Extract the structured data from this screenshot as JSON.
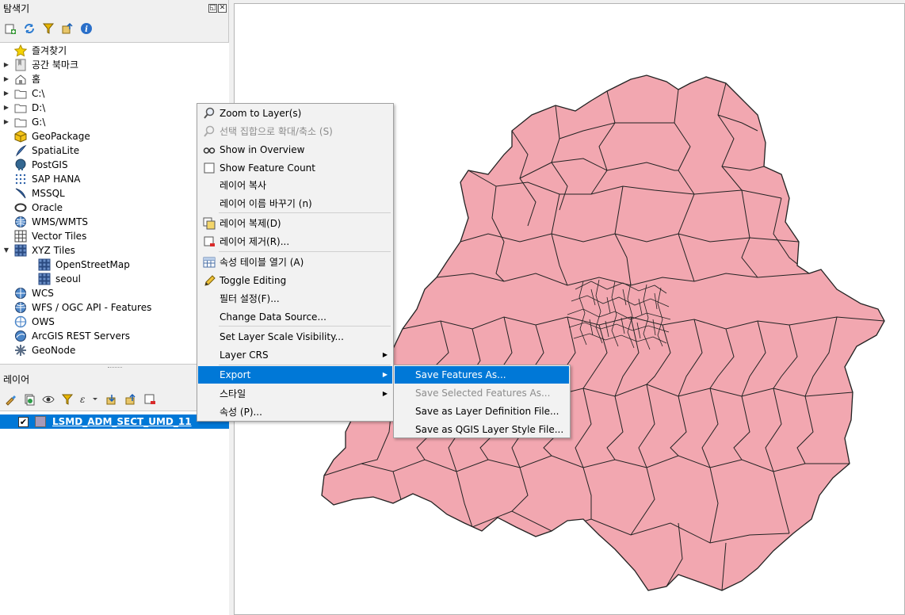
{
  "browser_panel": {
    "title": "탐색기",
    "tree": [
      {
        "label": "즐겨찾기",
        "icon": "star-icon",
        "arrow": ""
      },
      {
        "label": "공간 북마크",
        "icon": "bookmark-icon",
        "arrow": "▶"
      },
      {
        "label": "홈",
        "icon": "home-icon",
        "arrow": "▶"
      },
      {
        "label": "C:\\",
        "icon": "folder-icon",
        "arrow": "▶"
      },
      {
        "label": "D:\\",
        "icon": "folder-icon",
        "arrow": "▶"
      },
      {
        "label": "G:\\",
        "icon": "folder-icon",
        "arrow": "▶"
      },
      {
        "label": "GeoPackage",
        "icon": "geopackage-icon",
        "arrow": ""
      },
      {
        "label": "SpatiaLite",
        "icon": "spatialite-icon",
        "arrow": ""
      },
      {
        "label": "PostGIS",
        "icon": "postgis-icon",
        "arrow": ""
      },
      {
        "label": "SAP HANA",
        "icon": "sap-hana-icon",
        "arrow": ""
      },
      {
        "label": "MSSQL",
        "icon": "mssql-icon",
        "arrow": ""
      },
      {
        "label": "Oracle",
        "icon": "oracle-icon",
        "arrow": ""
      },
      {
        "label": "WMS/WMTS",
        "icon": "wms-icon",
        "arrow": ""
      },
      {
        "label": "Vector Tiles",
        "icon": "vector-tiles-icon",
        "arrow": ""
      },
      {
        "label": "XYZ Tiles",
        "icon": "xyz-tiles-icon",
        "arrow": "▼"
      },
      {
        "label": "OpenStreetMap",
        "icon": "tile-grid-icon",
        "arrow": ""
      },
      {
        "label": "seoul",
        "icon": "tile-grid-icon",
        "arrow": ""
      },
      {
        "label": "WCS",
        "icon": "wcs-icon",
        "arrow": ""
      },
      {
        "label": "WFS / OGC API - Features",
        "icon": "wfs-icon",
        "arrow": ""
      },
      {
        "label": "OWS",
        "icon": "ows-icon",
        "arrow": ""
      },
      {
        "label": "ArcGIS REST Servers",
        "icon": "arcgis-icon",
        "arrow": ""
      },
      {
        "label": "GeoNode",
        "icon": "geonode-icon",
        "arrow": ""
      }
    ]
  },
  "layers_panel": {
    "title": "레이어",
    "layer": {
      "name": "LSMD_ADM_SECT_UMD_11",
      "checked": "✔",
      "color": "#a89ab8"
    }
  },
  "context_menu": {
    "items": [
      {
        "label": "Zoom to Layer(s)",
        "icon": "zoom-layer-icon",
        "state": "normal"
      },
      {
        "label": "선택 집합으로 확대/축소 (S)",
        "icon": "zoom-selection-icon",
        "state": "disabled"
      },
      {
        "label": "Show in Overview",
        "icon": "overview-icon",
        "state": "normal"
      },
      {
        "label": "Show Feature Count",
        "icon": "checkbox-icon",
        "state": "normal"
      },
      {
        "label": "레이어 복사",
        "icon": "",
        "state": "normal"
      },
      {
        "label": "레이어 이름 바꾸기 (n)",
        "icon": "",
        "state": "normal"
      },
      {
        "label": "레이어 복제(D)",
        "icon": "duplicate-layer-icon",
        "state": "normal"
      },
      {
        "label": "레이어 제거(R)...",
        "icon": "remove-layer-icon",
        "state": "normal"
      },
      {
        "label": "속성 테이블 열기 (A)",
        "icon": "attribute-table-icon",
        "state": "normal"
      },
      {
        "label": "Toggle Editing",
        "icon": "pencil-icon",
        "state": "normal"
      },
      {
        "label": "필터 설정(F)...",
        "icon": "",
        "state": "normal"
      },
      {
        "label": "Change Data Source...",
        "icon": "",
        "state": "normal"
      },
      {
        "label": "Set Layer Scale Visibility...",
        "icon": "",
        "state": "normal"
      },
      {
        "label": "Layer CRS",
        "icon": "",
        "state": "submenu"
      },
      {
        "label": "Export",
        "icon": "",
        "state": "highlighted-submenu"
      },
      {
        "label": "스타일",
        "icon": "",
        "state": "submenu"
      },
      {
        "label": "속성 (P)...",
        "icon": "",
        "state": "normal"
      }
    ],
    "submenu_arrow": "▶"
  },
  "export_submenu": {
    "items": [
      {
        "label": "Save Features As...",
        "state": "highlighted"
      },
      {
        "label": "Save Selected Features As...",
        "state": "disabled"
      },
      {
        "label": "Save as Layer Definition File...",
        "state": "normal"
      },
      {
        "label": "Save as QGIS Layer Style File...",
        "state": "normal"
      }
    ]
  },
  "map": {
    "fill": "#f2a7b0",
    "stroke": "#222222"
  }
}
